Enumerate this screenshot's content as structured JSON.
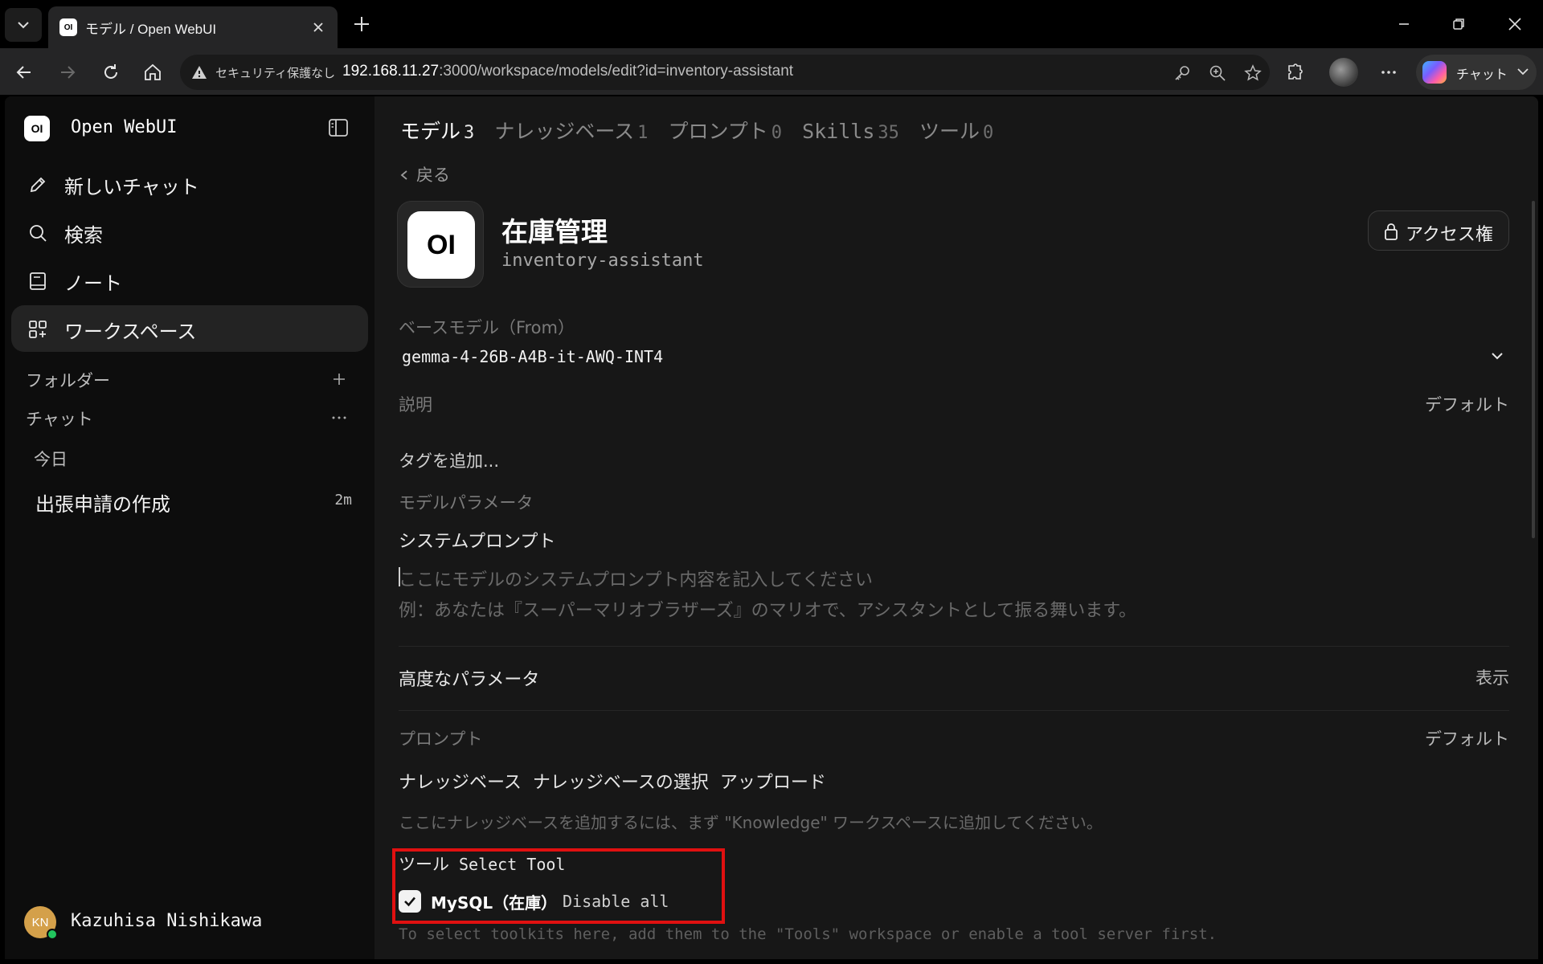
{
  "browser": {
    "tab_title": "モデル / Open WebUI",
    "security_label": "セキュリティ保護なし",
    "url_host": "192.168.11.27",
    "url_rest": ":3000/workspace/models/edit?id=inventory-assistant",
    "copilot_label": "チャット"
  },
  "sidebar": {
    "brand": "Open WebUI",
    "logo_text": "OI",
    "nav": [
      {
        "label": "新しいチャット",
        "icon": "pencil-icon"
      },
      {
        "label": "検索",
        "icon": "search-icon"
      },
      {
        "label": "ノート",
        "icon": "notebook-icon"
      },
      {
        "label": "ワークスペース",
        "icon": "workspace-grid-icon",
        "active": true
      }
    ],
    "folders_label": "フォルダー",
    "chats_label": "チャット",
    "today_label": "今日",
    "chat_items": [
      {
        "title": "出張申請の作成",
        "time": "2m"
      }
    ],
    "user": {
      "initials": "KN",
      "name": "Kazuhisa Nishikawa",
      "status_color": "#22c55e"
    }
  },
  "workspace_tabs": [
    {
      "label": "モデル",
      "count": "3",
      "active": true
    },
    {
      "label": "ナレッジベース",
      "count": "1"
    },
    {
      "label": "プロンプト",
      "count": "0"
    },
    {
      "label": "Skills",
      "count": "35"
    },
    {
      "label": "ツール",
      "count": "0"
    }
  ],
  "editor": {
    "back_label": "戻る",
    "avatar_text": "OI",
    "model_name": "在庫管理",
    "model_id": "inventory-assistant",
    "access_label": "アクセス権",
    "base_model_label": "ベースモデル（From）",
    "base_model_value": "gemma-4-26B-A4B-it-AWQ-INT4",
    "description_label": "説明",
    "description_value": "デフォルト",
    "tag_placeholder": "タグを追加...",
    "model_params_label": "モデルパラメータ",
    "system_prompt_label": "システムプロンプト",
    "system_prompt_placeholder_1": "ここにモデルのシステムプロンプト内容を記入してください",
    "system_prompt_placeholder_2": "例：あなたは『スーパーマリオブラザーズ』のマリオで、アシスタントとして振る舞います。",
    "advanced_params_label": "高度なパラメータ",
    "advanced_params_toggle": "表示",
    "prompts_label": "プロンプト",
    "prompts_value": "デフォルト",
    "knowledge_label": "ナレッジベース",
    "knowledge_select": "ナレッジベースの選択",
    "knowledge_upload": "アップロード",
    "knowledge_hint": "ここにナレッジベースを追加するには、まず \"Knowledge\" ワークスペースに追加してください。",
    "tools_label": "ツール",
    "tools_select": "Select Tool",
    "tool_name": "MySQL（在庫）",
    "tool_checked": true,
    "disable_all": "Disable all",
    "tools_hint": "To select toolkits here, add them to the \"Tools\" workspace or enable a tool server first.",
    "highlight_color": "#e01010"
  }
}
